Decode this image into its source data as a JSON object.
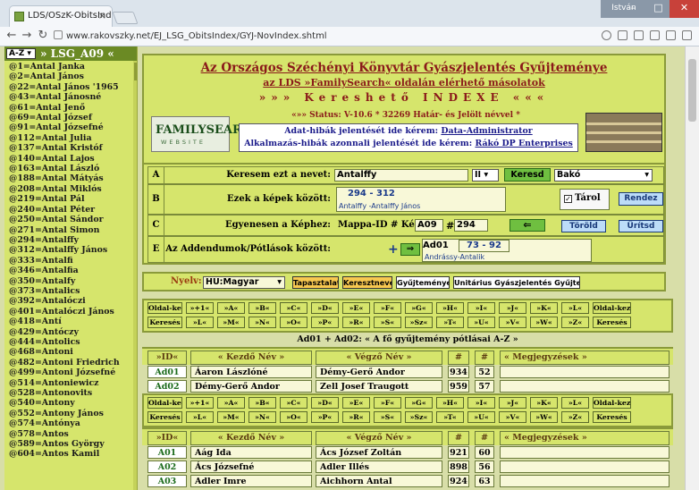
{
  "browser": {
    "tab_title": "LDS/OSzK-ObitsIndex",
    "url": "www.rakovszky.net/EJ_LSG_ObitsIndex/GYJ-NovIndex.shtml",
    "window_user": "István"
  },
  "sidebar": {
    "selector": "A-Z",
    "title": "» LSG_A09 «",
    "items": [
      "@1=Antal Janka",
      "@2=Antal János",
      "@22=Antal János '1965",
      "@43=Antal Jánosné",
      "@61=Antal Jenő",
      "@69=Antal József",
      "@91=Antal Józsefné",
      "@112=Antal Julia",
      "@137=Antal Kristóf",
      "@140=Antal Lajos",
      "@163=Antal László",
      "@188=Antal Mátyás",
      "@208=Antal Miklós",
      "@219=Antal Pál",
      "@240=Antal Péter",
      "@250=Antal Sándor",
      "@271=Antal Simon",
      "@294=Antalffy",
      "@312=Antalffy János",
      "@333=Antalfi",
      "@346=Antalfia",
      "@350=Antalfy",
      "@373=Antalics",
      "@392=Antalóczi",
      "@401=Antalóczi János",
      "@418=Antí",
      "@429=Antóczy",
      "@444=Antolics",
      "@468=Antoni",
      "@482=Antoni Friedrich",
      "@499=Antoni Józsefné",
      "@514=Antoniewicz",
      "@528=Antonovits",
      "@540=Antony",
      "@552=Antony János",
      "@574=Antónya",
      "@578=Antos",
      "@589=Antos György",
      "@604=Antos Kamil"
    ]
  },
  "header": {
    "title": "Az Országos Széchényi Könyvtár Gyászjelentés Gyűjteménye",
    "subtitle": "az LDS »FamilySearch« oldalán elérhető másolatok",
    "index_title": "»»» Kereshető INDEXE «««",
    "logo_top": "FAMILYSEARCH",
    "logo_bottom": "WEBSITE",
    "status": "«»» Status: V-10.6 * 32269 Határ- és Jelölt névvel *",
    "link1_prefix": "Adat-hibák jelentését ide kérem:",
    "link1": "Data-Administrator",
    "link2_prefix": "Alkalmazás-hibák azonnali jelentését ide kérem:",
    "link2": "Rákó DP Enterprises"
  },
  "form": {
    "a_label": "A",
    "a_text": "Keresem ezt a nevet:",
    "a_value": "Antalffy",
    "a_mode": "II",
    "a_button": "Keresd",
    "a_select": "Bakó",
    "b_label": "B",
    "b_text": "Ezek a képek között:",
    "b_range": "294 - 312",
    "b_names": "Antalffy -Antalffy János",
    "b_check": "Tárol",
    "b_button": "Rendez",
    "c_label": "C",
    "c_text": "Egyenesen a Képhez:",
    "c_mappa": "Mappa-ID # Kép:",
    "c_folder": "A09",
    "c_hash": "#",
    "c_image": "294",
    "c_btn1": "Töröld",
    "c_btn2": "Ürítsd",
    "e_label": "E",
    "e_text": "Az Addendumok/Pótlások között:",
    "e_plus": "+",
    "e_code": "Ad01",
    "e_range": "73 - 92",
    "e_names": "Andrássy-Antalik"
  },
  "lang": {
    "label": "Nyelv:",
    "value": "HU:Magyar",
    "buttons": [
      "Tapasztalatok",
      "Keresztnevek",
      "Gyűjtemények",
      "Unitárius Gyászjelentés Gyűjtemény"
    ]
  },
  "letters_row1": [
    "Oldal-kezd.",
    "»+1«",
    "»A«",
    "»B«",
    "»C«",
    "»D«",
    "»E«",
    "»F«",
    "»G«",
    "»H«",
    "»I«",
    "»J«",
    "»K«",
    "»L«",
    "Oldal-kezd."
  ],
  "letters_row2": [
    "Keresés",
    "»L«",
    "»M«",
    "»N«",
    "»O«",
    "»P«",
    "»R«",
    "»S«",
    "»Sz«",
    "»T«",
    "»U«",
    "»V«",
    "»W«",
    "»Z«",
    "Keresés"
  ],
  "section_title": "Ad01 + Ad02:  « A fő gyűjtemény pótlásai A-Z »",
  "table1": {
    "headers": [
      "»ID«",
      "« Kezdő Név »",
      "« Végző Név »",
      "#",
      "#",
      "« Megjegyzések »"
    ],
    "rows": [
      [
        "Ad01",
        "Áaron Lászlóné",
        "Démy-Gerő Andor",
        "934",
        "52",
        ""
      ],
      [
        "Ad02",
        "Démy-Gerő Andor",
        "Zell Josef Traugott",
        "959",
        "57",
        ""
      ]
    ]
  },
  "table2": {
    "headers": [
      "»ID«",
      "« Kezdő Név »",
      "« Végző Név »",
      "#",
      "#",
      "« Megjegyzések »"
    ],
    "rows": [
      [
        "A01",
        "Aág Ida",
        "Ács József Zoltán",
        "921",
        "60",
        ""
      ],
      [
        "A02",
        "Ács Józsefné",
        "Adler Illés",
        "898",
        "56",
        ""
      ],
      [
        "A03",
        "Adler Imre",
        "Aichhorn Antal",
        "924",
        "63",
        ""
      ]
    ]
  }
}
